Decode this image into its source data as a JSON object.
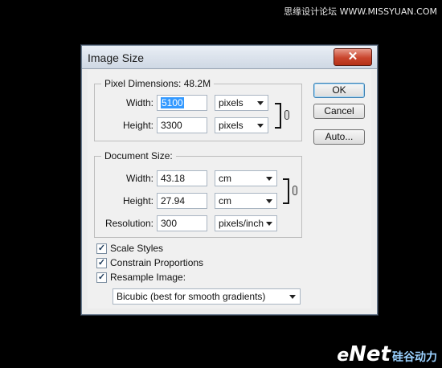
{
  "watermark": {
    "top_text": "思缘设计论坛 WWW.MISSYUAN.COM",
    "bottom_e": "e",
    "bottom_net": "Net",
    "bottom_cn": "硅谷动力"
  },
  "dialog": {
    "title": "Image Size",
    "close_glyph": "✕",
    "pixel_dimensions": {
      "legend": "Pixel Dimensions:",
      "size": "48.2M",
      "width_label": "Width:",
      "width_value": "5100",
      "width_unit": "pixels",
      "height_label": "Height:",
      "height_value": "3300",
      "height_unit": "pixels"
    },
    "document_size": {
      "legend": "Document Size:",
      "width_label": "Width:",
      "width_value": "43.18",
      "width_unit": "cm",
      "height_label": "Height:",
      "height_value": "27.94",
      "height_unit": "cm",
      "resolution_label": "Resolution:",
      "resolution_value": "300",
      "resolution_unit": "pixels/inch"
    },
    "buttons": {
      "ok": "OK",
      "cancel": "Cancel",
      "auto": "Auto..."
    },
    "options": {
      "scale_styles": {
        "label": "Scale Styles",
        "checked": true
      },
      "constrain_proportions": {
        "label": "Constrain Proportions",
        "checked": true
      },
      "resample_image": {
        "label": "Resample Image:",
        "checked": true
      },
      "resample_method": "Bicubic (best for smooth gradients)"
    },
    "check_glyph": "✓",
    "icons": {
      "close": "close-icon",
      "link": "chain-link-icon",
      "dropdown": "chevron-down-icon"
    }
  }
}
